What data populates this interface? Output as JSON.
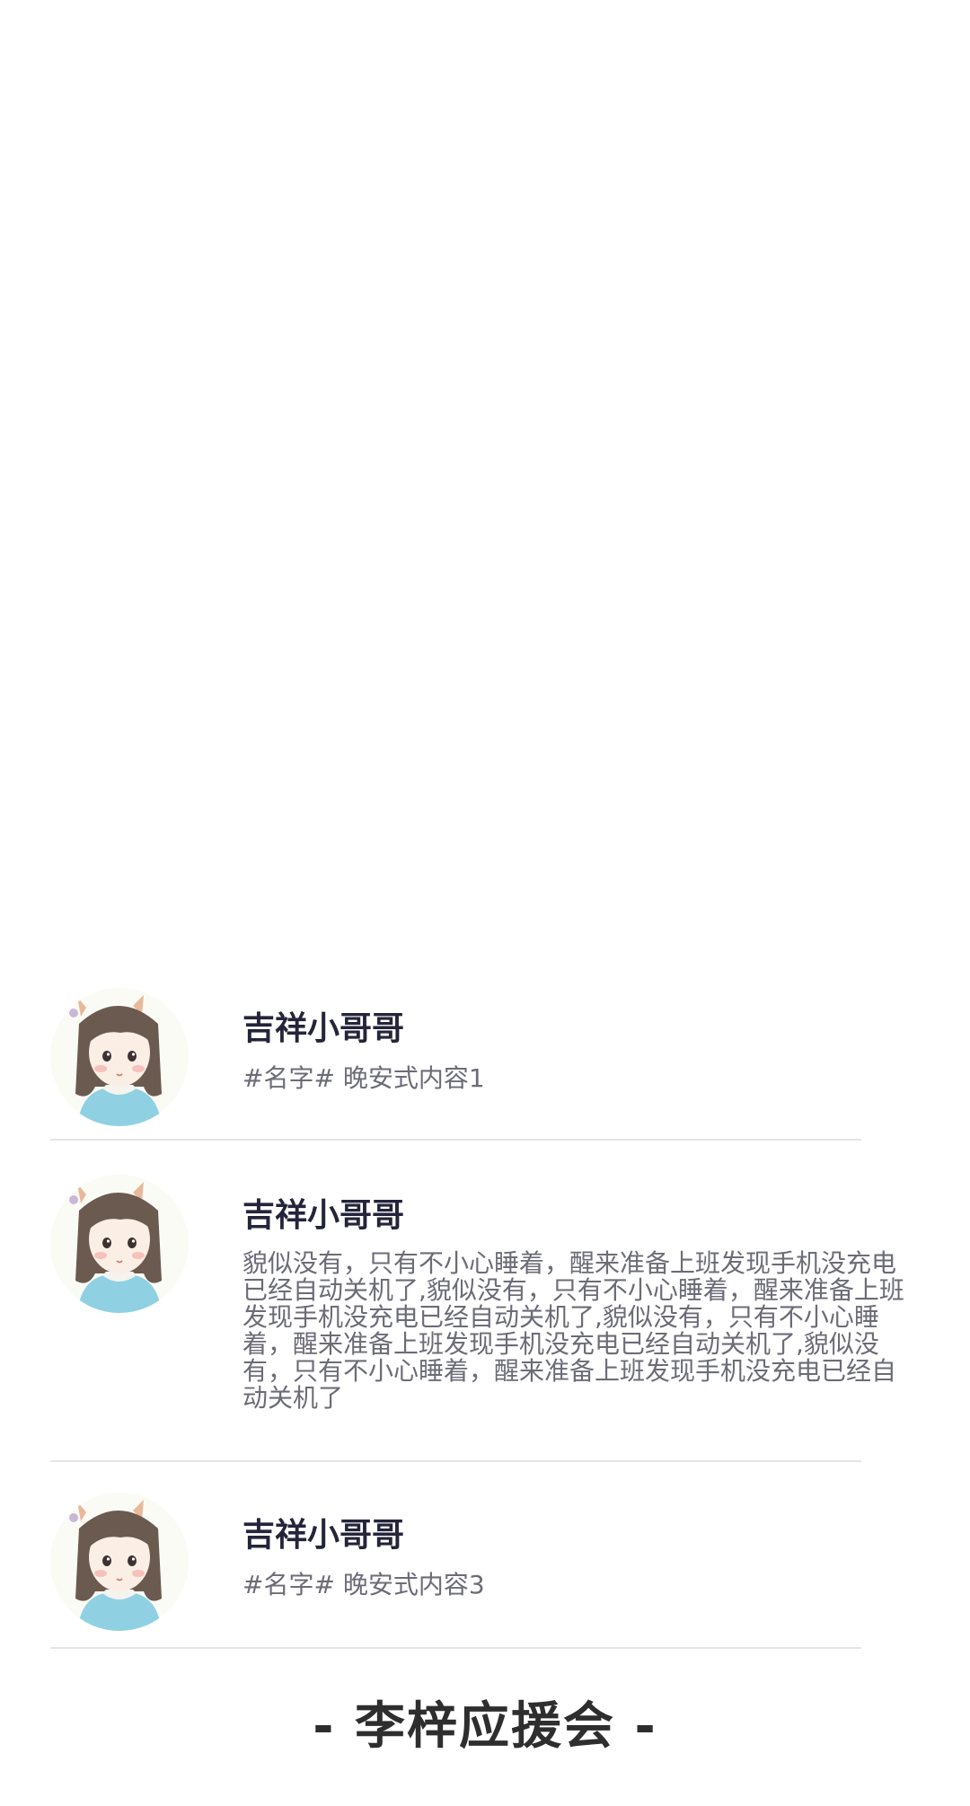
{
  "feed": {
    "items": [
      {
        "avatar": "girl-avatar-icon",
        "name": "吉祥小哥哥",
        "content": "#名字# 晚安式内容1"
      },
      {
        "avatar": "girl-avatar-icon",
        "name": "吉祥小哥哥",
        "content": "貌似没有，只有不小心睡着，醒来准备上班发现手机没充电已经自动关机了,貌似没有，只有不小心睡着，醒来准备上班发现手机没充电已经自动关机了,貌似没有，只有不小心睡着，醒来准备上班发现手机没充电已经自动关机了,貌似没有，只有不小心睡着，醒来准备上班发现手机没充电已经自动关机了"
      },
      {
        "avatar": "girl-avatar-icon",
        "name": "吉祥小哥哥",
        "content": "#名字# 晚安式内容3"
      }
    ]
  },
  "footer": {
    "title": "- 李梓应援会 -"
  }
}
